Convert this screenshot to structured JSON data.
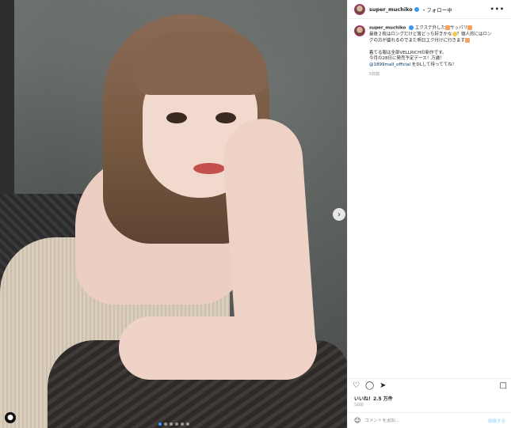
{
  "post": {
    "username": "super_muchiko",
    "follow_status": "フォロー中",
    "more_label": "•••",
    "caption": {
      "username": "super_muchiko",
      "line1_a": "エクステ外した",
      "line1_b": "サッパリ",
      "line2_a": "最後２枚はロングだけど皆どっち好きかな",
      "line2_b": "？個人的にはロン",
      "line3": "グの方が盛れるのでまた明日エク付けに行きます",
      "line4": "着てる服は全部VELLRICHの新作です。",
      "line5": "今月の28日に発売予定デース！万歳！",
      "line6_mention": "@1899mall_official",
      "line6_rest": " をDLして待っててね！",
      "time": "5日前"
    },
    "likes": "いいね！2.5 万件",
    "posted_time": "5日前"
  },
  "comment": {
    "placeholder": "コメントを追加...",
    "post_label": "投稿する"
  },
  "icons": {
    "heart": "heart-icon",
    "comment": "comment-icon",
    "share": "share-icon",
    "save": "bookmark-icon",
    "smile": "emoji-icon",
    "next": "chevron-right-icon",
    "user_tag": "user-icon"
  },
  "carousel": {
    "count": 6,
    "active": 1
  },
  "colors": {
    "verified": "#3897f0",
    "link": "#00376b",
    "post_button": "#b2dffc"
  }
}
